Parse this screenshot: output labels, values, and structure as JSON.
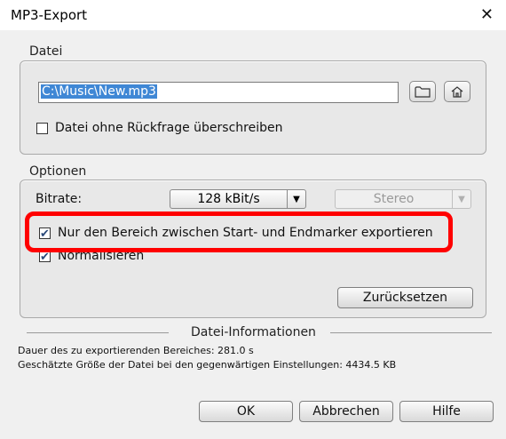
{
  "window": {
    "title": "MP3-Export",
    "close_glyph": "✕"
  },
  "datei": {
    "label": "Datei",
    "path_value": "C:\\Music\\New.mp3",
    "overwrite_label": "Datei ohne Rückfrage überschreiben",
    "overwrite_checked": false
  },
  "optionen": {
    "label": "Optionen",
    "bitrate_label": "Bitrate:",
    "bitrate_value": "128 kBit/s",
    "channel_value": "Stereo",
    "range_label": "Nur den Bereich zwischen Start- und Endmarker exportieren",
    "range_checked": true,
    "normalize_label": "Normalisieren",
    "normalize_checked": true,
    "reset_label": "Zurücksetzen"
  },
  "info": {
    "header": "Datei-Informationen",
    "duration_text": "Dauer des zu exportierenden Bereiches:  281.0 s",
    "size_text": "Geschätzte Größe der Datei bei den gegenwärtigen Einstellungen:  4434.5 KB"
  },
  "buttons": {
    "ok": "OK",
    "cancel": "Abbrechen",
    "help": "Hilfe"
  },
  "colors": {
    "highlight": "#ff0000",
    "selection": "#3f87d5"
  },
  "icons": {
    "browse": "folder-icon",
    "home": "home-icon"
  }
}
